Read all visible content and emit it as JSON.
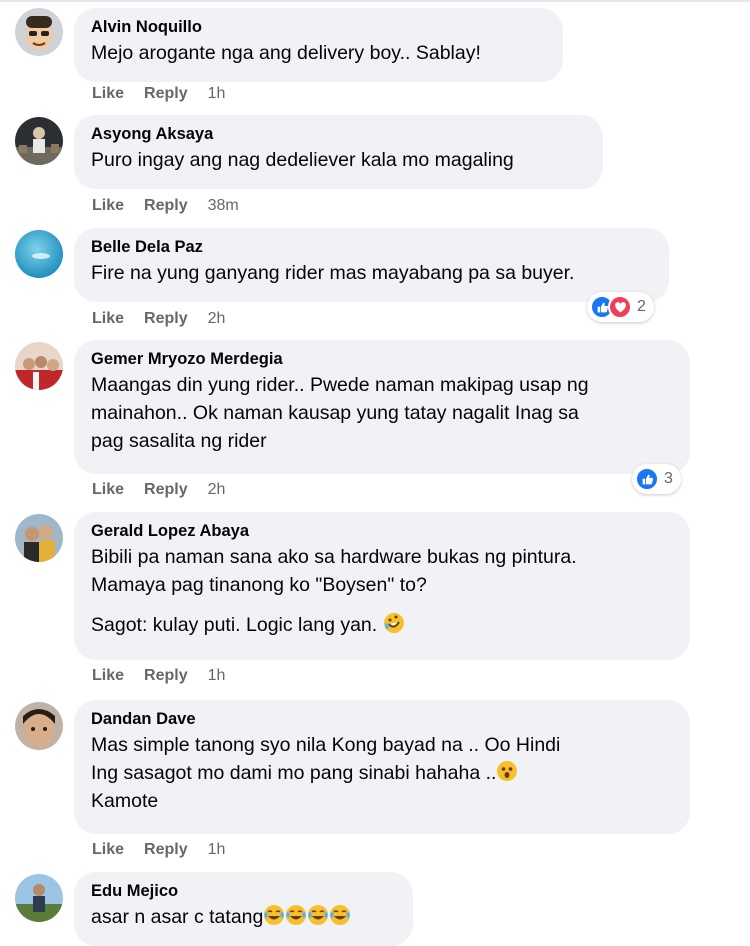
{
  "actions": {
    "like": "Like",
    "reply": "Reply"
  },
  "comments": [
    {
      "author": "Alvin Noquillo",
      "lines": [
        "Mejo arogante nga ang delivery boy.. Sablay!"
      ],
      "time": "1h",
      "avatar": "cartoon-avatar"
    },
    {
      "author": "Asyong Aksaya",
      "lines": [
        "Puro ingay ang nag dedeliever kala mo magaling"
      ],
      "time": "38m",
      "avatar": "photo-avatar"
    },
    {
      "author": "Belle Dela Paz",
      "lines": [
        "Fire na yung ganyang rider mas mayabang pa sa buyer."
      ],
      "time": "2h",
      "reaction_count": "2",
      "avatar": "ocean-avatar"
    },
    {
      "author": "Gemer Mryozo Merdegia",
      "lines": [
        "Maangas din yung rider.. Pwede naman makipag usap ng",
        "mainahon.. Ok naman kausap yung tatay nagalit Inag sa",
        "pag sasalita ng rider"
      ],
      "time": "2h",
      "reaction_count": "3",
      "avatar": "group-avatar"
    },
    {
      "author": "Gerald Lopez Abaya",
      "lines": [
        "Bibili pa naman sana ako sa hardware bukas ng pintura.",
        "Mamaya pag tinanong ko \"Boysen\" to?"
      ],
      "extra": "Sagot: kulay puti. Logic lang yan.",
      "time": "1h",
      "avatar": "couple-avatar"
    },
    {
      "author": "Dandan Dave",
      "lines": [
        "Mas simple tanong syo nila Kong bayad na .. Oo Hindi",
        "Ing sasagot mo dami mo pang sinabi hahaha ..",
        "Kamote"
      ],
      "time": "1h",
      "avatar": "selfie-avatar"
    },
    {
      "author": "Edu Mejico",
      "lines": [
        "asar n asar c tatang"
      ],
      "avatar": "outdoor-avatar"
    }
  ],
  "colors": {
    "bubble": "#f0f2f5",
    "meta": "#65676b",
    "like": "#1877f2",
    "love": "#f33e58"
  }
}
